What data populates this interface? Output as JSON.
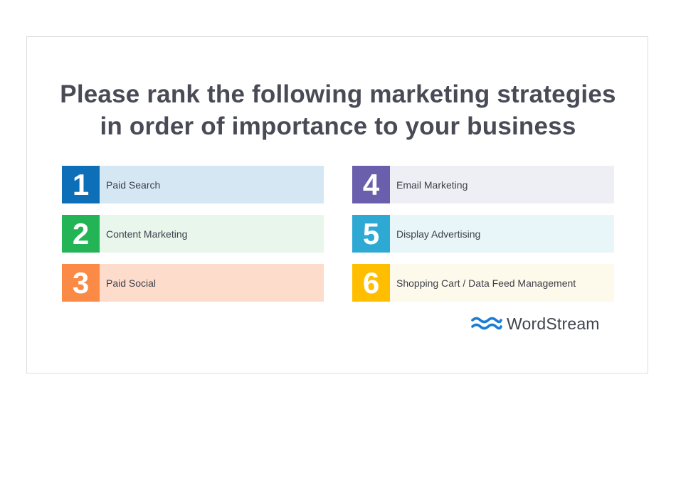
{
  "title": {
    "line1": "Please rank the following marketing strategies",
    "line2": "in order of importance to your business"
  },
  "items": [
    {
      "number": "1",
      "label": "Paid Search",
      "badge_color": "#0d6fb8",
      "bg_color": "#d6e7f4"
    },
    {
      "number": "2",
      "label": "Content Marketing",
      "badge_color": "#22b455",
      "bg_color": "#e9f6ec"
    },
    {
      "number": "3",
      "label": "Paid Social",
      "badge_color": "#fa8a45",
      "bg_color": "#fddccb"
    },
    {
      "number": "4",
      "label": "Email Marketing",
      "badge_color": "#6a5fad",
      "bg_color": "#eeeff5"
    },
    {
      "number": "5",
      "label": "Display Advertising",
      "badge_color": "#2ea9d4",
      "bg_color": "#e8f5f9"
    },
    {
      "number": "6",
      "label": "Shopping Cart / Data Feed Management",
      "badge_color": "#ffbf00",
      "bg_color": "#fefaeb"
    }
  ],
  "logo": {
    "text": "WordStream",
    "icon": "wave-logo-icon",
    "color": "#1a7fd4"
  }
}
